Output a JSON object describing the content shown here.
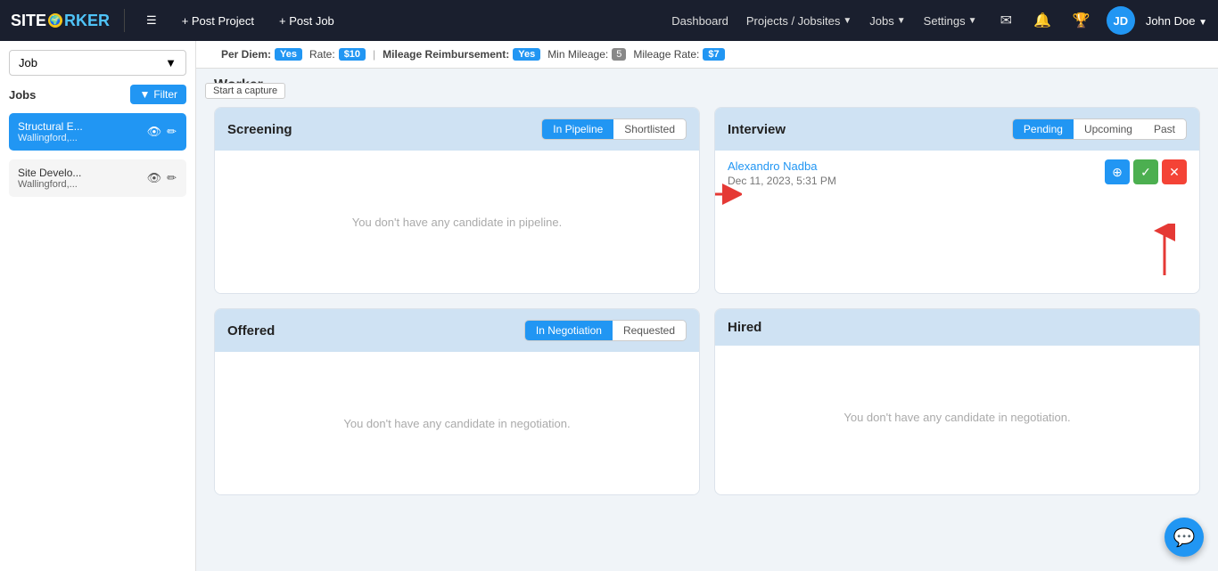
{
  "topnav": {
    "logo": "SITEW🌎RKER",
    "logo_site": "SITE",
    "logo_worker": "RKER",
    "menu_icon": "☰",
    "post_project": "+ Post Project",
    "post_job": "+ Post Job",
    "dashboard": "Dashboard",
    "projects_jobsites": "Projects / Jobsites",
    "jobs": "Jobs",
    "settings": "Settings",
    "user_initials": "JD",
    "user_name": "John Doe"
  },
  "sidebar": {
    "dropdown_value": "Job",
    "section_label": "Jobs",
    "filter_label": "Filter",
    "items": [
      {
        "id": "structural",
        "line1": "Structural E...",
        "line2": "Wallingford,...",
        "active": true
      },
      {
        "id": "site",
        "line1": "Site Develo...",
        "line2": "Wallingford,...",
        "active": false
      }
    ]
  },
  "info_bar": {
    "per_diem_label": "Per Diem:",
    "per_diem_value": "Yes",
    "rate_label": "Rate:",
    "rate_value": "$10",
    "sep1": "|",
    "mileage_label": "Mileage Reimbursement:",
    "mileage_value": "Yes",
    "min_mileage_label": "Min Mileage:",
    "min_mileage_value": "5",
    "mileage_rate_label": "Mileage Rate:",
    "mileage_rate_value": "$7",
    "tooltip": "Start a capture"
  },
  "worker_title": "Worker",
  "cards": {
    "screening": {
      "title": "Screening",
      "tabs": [
        {
          "label": "In Pipeline",
          "active": true
        },
        {
          "label": "Shortlisted",
          "active": false
        }
      ],
      "empty_text": "You don't have any candidate in pipeline."
    },
    "interview": {
      "title": "Interview",
      "tabs": [
        {
          "label": "Pending",
          "active": true
        },
        {
          "label": "Upcoming",
          "active": false
        },
        {
          "label": "Past",
          "active": false
        }
      ],
      "candidate": {
        "name": "Alexandro Nadba",
        "date": "Dec 11, 2023, 5:31 PM"
      },
      "action_btns": [
        {
          "type": "blue",
          "icon": "⊕",
          "label": "info"
        },
        {
          "type": "green",
          "icon": "✓",
          "label": "approve"
        },
        {
          "type": "red",
          "icon": "✕",
          "label": "reject"
        }
      ]
    },
    "offered": {
      "title": "Offered",
      "tabs": [
        {
          "label": "In Negotiation",
          "active": true
        },
        {
          "label": "Requested",
          "active": false
        }
      ],
      "empty_text": "You don't have any candidate in negotiation."
    },
    "hired": {
      "title": "Hired",
      "tabs": [],
      "empty_text": "You don't have any candidate in negotiation."
    }
  },
  "chat_icon": "💬"
}
